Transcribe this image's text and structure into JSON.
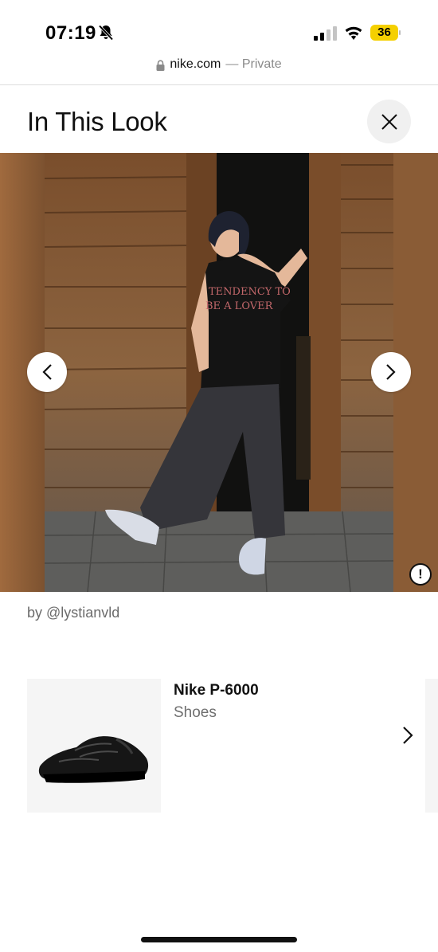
{
  "status_bar": {
    "time": "07:19",
    "battery": "36",
    "icons": [
      "bell-slash-icon",
      "cellular-signal-icon",
      "wifi-icon",
      "battery-icon"
    ],
    "battery_color": "#f5d000"
  },
  "browser": {
    "domain": "nike.com",
    "mode": "— Private"
  },
  "header": {
    "title": "In This Look",
    "close_icon": "close-icon"
  },
  "gallery": {
    "prev_icon": "chevron-left-icon",
    "next_icon": "chevron-right-icon",
    "report_label": "!",
    "shirt_text_line1": "TENDENCY TO",
    "shirt_text_line2": "BE A LOVER",
    "credit": "by @lystianvld"
  },
  "products": [
    {
      "name": "Nike P-6000",
      "category": "Shoes",
      "image_icon": "black-sneaker-image"
    }
  ],
  "colors": {
    "text_primary": "#111111",
    "text_secondary": "#707070",
    "card_bg": "#f5f5f5",
    "close_bg": "#f0f0f0"
  }
}
